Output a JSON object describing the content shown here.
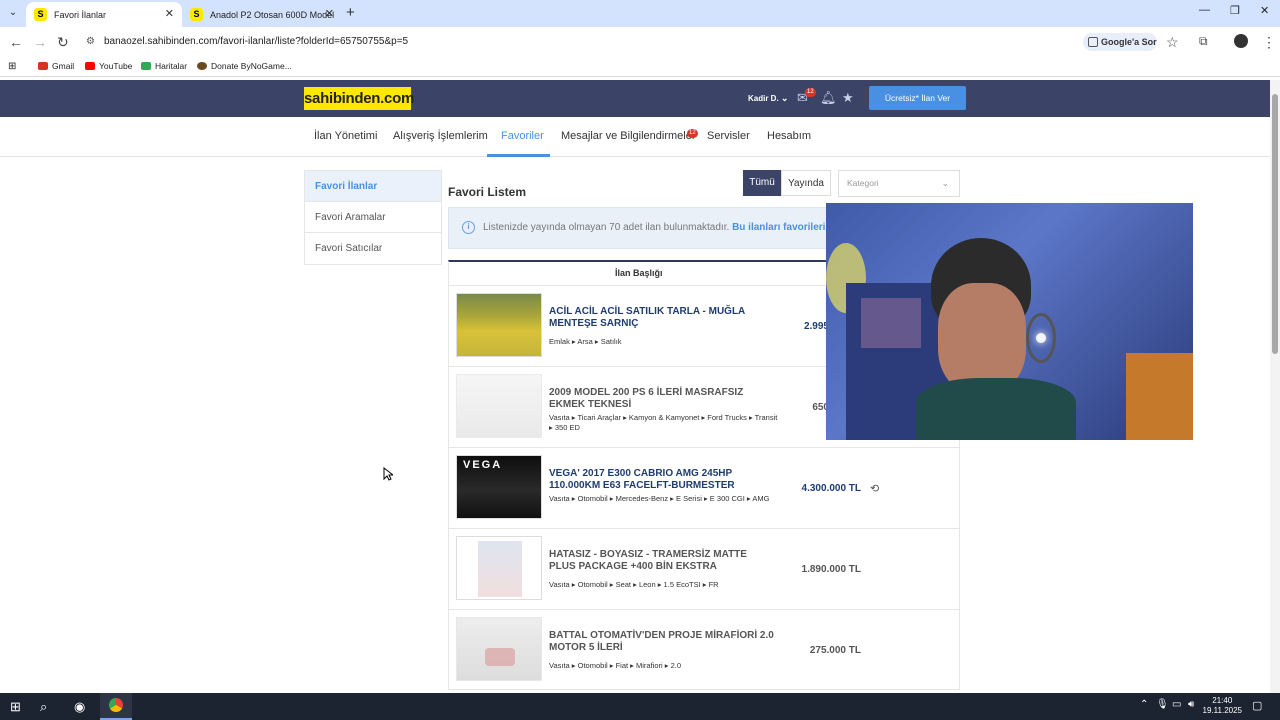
{
  "browser": {
    "tabs": [
      {
        "label": "Favori İlanlar",
        "active": true
      },
      {
        "label": "Anadol P2 Otosan 600D Model",
        "active": false
      }
    ],
    "url": "banaozel.sahibinden.com/favori-ilanlar/liste?folderId=65750755&p=5",
    "google_sor": "Google'a Sor",
    "bookmarks": [
      "Gmail",
      "YouTube",
      "Haritalar",
      "Donate ByNoGame..."
    ]
  },
  "header": {
    "logo": "sahibinden.com",
    "user": "Kadir D.",
    "message_badge": "12",
    "cta": "Ücretsiz* İlan Ver"
  },
  "nav": {
    "items": [
      "İlan Yönetimi",
      "Alışveriş İşlemlerim",
      "Favoriler",
      "Mesajlar ve Bilgilendirmeler",
      "Servisler",
      "Hesabım"
    ],
    "messages_badge": "12"
  },
  "sidebar": {
    "items": [
      "Favori İlanlar",
      "Favori Aramalar",
      "Favori Satıcılar"
    ]
  },
  "content": {
    "title": "Favori Listem",
    "filter_all": "Tümü",
    "filter_live": "Yayında",
    "category_placeholder": "Kategori",
    "info_text": "Listenizde yayında olmayan 70 adet ilan bulunmaktadır.",
    "info_link": "Bu ilanları favorilerin",
    "column_header": "İlan Başlığı"
  },
  "listings": [
    {
      "title": "ACİL ACİL ACİL SATILIK TARLA - MUĞLA MENTEŞE SARNIÇ",
      "crumbs": "Emlak ▸ Arsa ▸ Satılık",
      "price": "2.995",
      "faded": false
    },
    {
      "title": "2009 MODEL 200 PS 6 İLERİ MASRAFSIZ EKMEK TEKNESİ",
      "crumbs": "Vasıta ▸ Ticari Araçlar ▸ Kamyon & Kamyonet ▸ Ford Trucks ▸ Transit ▸ 350 ED",
      "price": "650",
      "faded": true
    },
    {
      "title": "VEGA' 2017 E300 CABRIO AMG 245HP 110.000KM E63 FACELFT-BURMESTER",
      "crumbs": "Vasıta ▸ Otomobil ▸ Mercedes-Benz ▸ E Serisi ▸ E 300 CGI ▸ AMG",
      "price": "4.300.000 TL",
      "faded": false
    },
    {
      "title": "HATASIZ - BOYASIZ - TRAMERSİZ MATTE PLUS PACKAGE +400 BİN EKSTRA",
      "crumbs": "Vasıta ▸ Otomobil ▸ Seat ▸ Leon ▸ 1.5 EcoTSI ▸ FR",
      "price": "1.890.000 TL",
      "faded": true
    },
    {
      "title": "BATTAL OTOMATİV'DEN PROJE MİRAFİORİ 2.0 MOTOR 5 İLERİ",
      "crumbs": "Vasıta ▸ Otomobil ▸ Fiat ▸ Mirafiori ▸ 2.0",
      "price": "275.000 TL",
      "faded": true
    }
  ],
  "taskbar": {
    "time": "21:40",
    "date": "19.11.2025"
  },
  "colors": {
    "brand_yellow": "#ffe800",
    "header_bg": "#3b4466",
    "accent": "#4a90e2"
  }
}
